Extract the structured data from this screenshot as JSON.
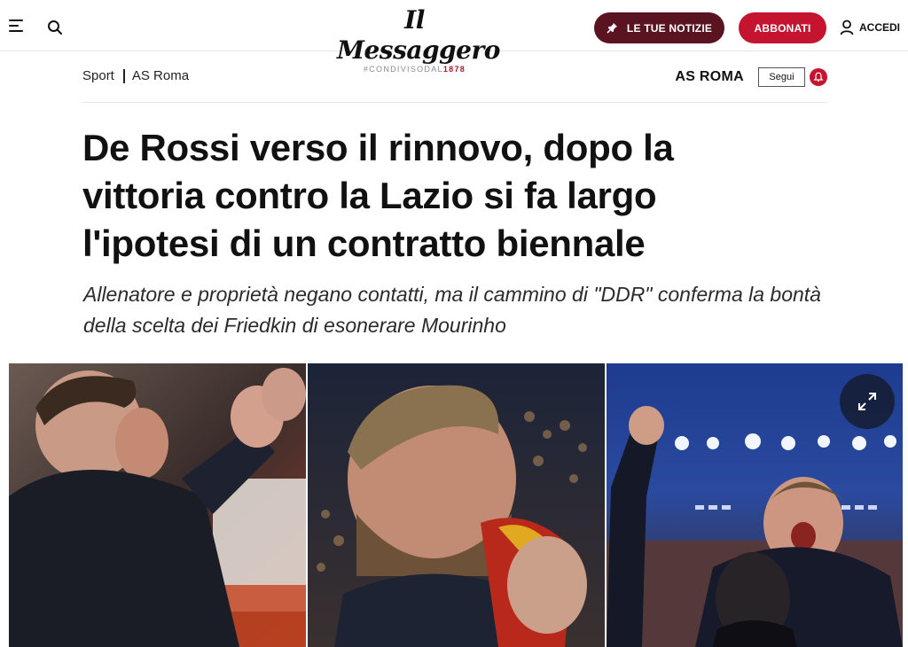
{
  "header": {
    "logo_text": "Il Messaggero",
    "logo_tag_prefix": "#CONDIVISODAL",
    "logo_tag_year": "1878",
    "notizie_label": "LE TUE NOTIZIE",
    "abbonati_label": "ABBONATI",
    "login_label": "ACCEDI",
    "notizie_color": "#5a1320",
    "abbonati_color": "#c4142f"
  },
  "breadcrumb": {
    "section": "Sport",
    "subsection": "AS Roma"
  },
  "topic": {
    "name": "AS ROMA",
    "follow_label": "Segui"
  },
  "article": {
    "headline": "De Rossi verso il rinnovo, dopo la vittoria contro la Lazio si fa largo l'ipotesi di un contratto biennale",
    "subheadline": "Allenatore e proprietà negano contatti, ma il cammino di \"DDR\" conferma la bontà della scelta dei Friedkin di esonerare Mourinho"
  },
  "icons": {
    "menu": "hamburger-menu-icon",
    "search": "search-icon",
    "pin": "pin-icon",
    "user": "user-icon",
    "bell": "bell-icon",
    "expand": "expand-icon"
  }
}
